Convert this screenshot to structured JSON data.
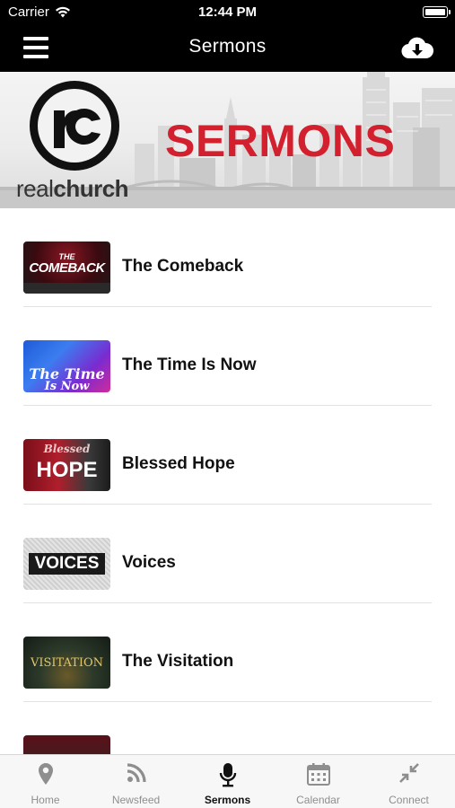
{
  "status_bar": {
    "carrier": "Carrier",
    "time": "12:44 PM"
  },
  "nav": {
    "title": "Sermons",
    "menu_icon": "hamburger-menu-icon",
    "download_icon": "cloud-download-icon"
  },
  "banner": {
    "logo_word_light": "real",
    "logo_word_bold": "church",
    "title": "SERMONS",
    "accent_color": "#d3202f"
  },
  "sermons": [
    {
      "title": "The Comeback",
      "thumb_text": "COMEBACK",
      "thumb_sub": "THE"
    },
    {
      "title": "The Time Is Now",
      "thumb_text": "The Time",
      "thumb_sub": "Is Now"
    },
    {
      "title": "Blessed Hope",
      "thumb_text": "HOPE",
      "thumb_sub": "Blessed"
    },
    {
      "title": "Voices",
      "thumb_text": "VOICES",
      "thumb_sub": ""
    },
    {
      "title": "The Visitation",
      "thumb_text": "VISITATION",
      "thumb_sub": ""
    }
  ],
  "tabs": [
    {
      "label": "Home",
      "icon": "map-pin-icon"
    },
    {
      "label": "Newsfeed",
      "icon": "rss-icon"
    },
    {
      "label": "Sermons",
      "icon": "microphone-icon",
      "active": true
    },
    {
      "label": "Calendar",
      "icon": "calendar-icon"
    },
    {
      "label": "Connect",
      "icon": "arrows-in-icon"
    }
  ]
}
